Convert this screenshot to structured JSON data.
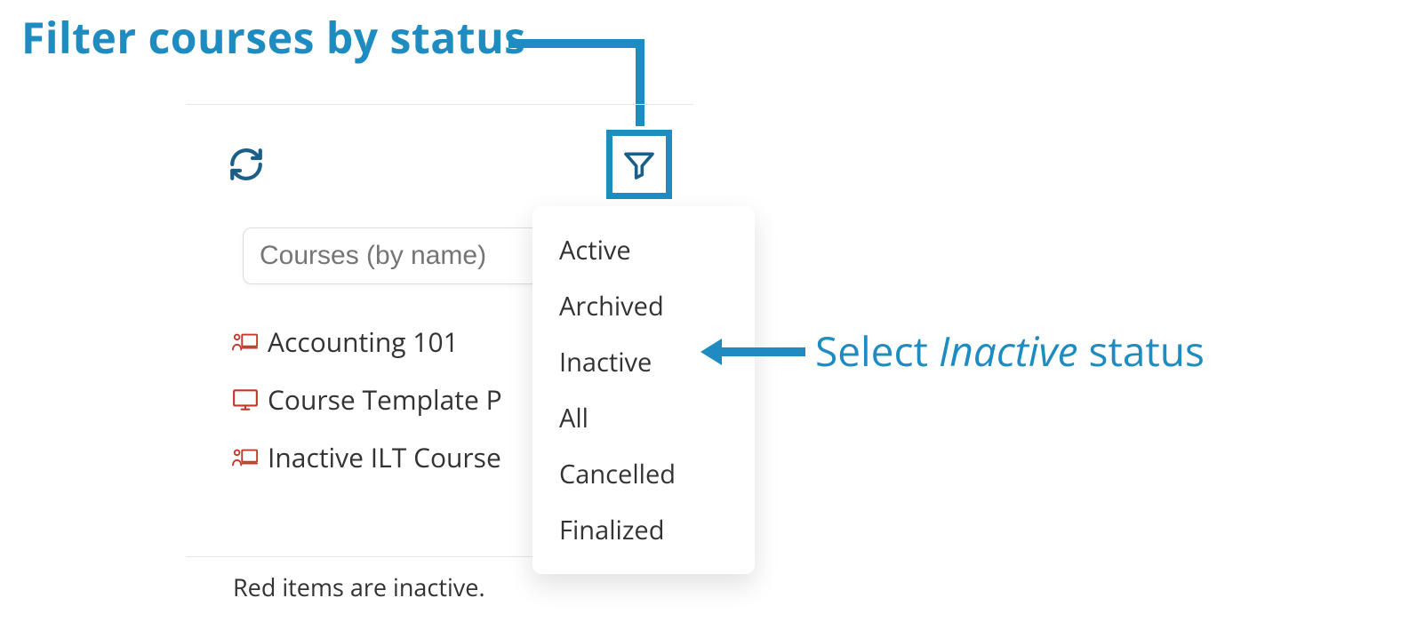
{
  "annotations": {
    "filter_heading": "Filter courses by status",
    "select_prefix": "Select ",
    "select_emph": "Inactive",
    "select_suffix": " status"
  },
  "panel": {
    "search_placeholder": "Courses (by name)",
    "footer_note": "Red items are inactive."
  },
  "courses": [
    {
      "label": "Accounting 101",
      "type": "ilt"
    },
    {
      "label": "Course Template P",
      "type": "online"
    },
    {
      "label": "Inactive ILT Course",
      "type": "ilt"
    }
  ],
  "filter_options": [
    "Active",
    "Archived",
    "Inactive",
    "All",
    "Cancelled",
    "Finalized"
  ],
  "colors": {
    "accent": "#1e8cc1",
    "icon_primary": "#1b5f88",
    "inactive_red": "#c0392b"
  }
}
